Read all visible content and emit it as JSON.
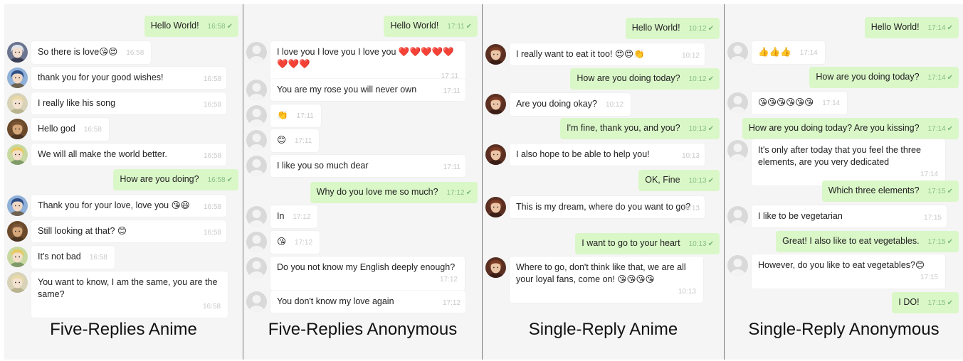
{
  "figure_colors": {
    "background": "#f5f5f5",
    "outgoing_bubble": "#daf7c8",
    "incoming_bubble": "#ffffff",
    "divider": "#7a7a7a"
  },
  "panels": [
    {
      "caption": "Five-Replies Anime",
      "messages": [
        {
          "dir": "out",
          "text": "Hello World!",
          "time": "16:58"
        },
        {
          "dir": "in",
          "avatar": "anime-silver",
          "text": "So there is love😘😍",
          "time": "16:58"
        },
        {
          "dir": "in",
          "avatar": "anime-blue",
          "text": "thank you for your good wishes!",
          "time": "16:58"
        },
        {
          "dir": "in",
          "avatar": "anime-blonde-light",
          "text": "I really like his song",
          "time": "16:58"
        },
        {
          "dir": "in",
          "avatar": "anime-bald",
          "text": "Hello god",
          "time": "16:58"
        },
        {
          "dir": "in",
          "avatar": "anime-blonde",
          "text": "We will all make the world better.",
          "time": "16:58"
        },
        {
          "dir": "out",
          "text": "How are you doing?",
          "time": "16:58"
        },
        {
          "dir": "in",
          "avatar": "anime-blue",
          "text": "Thank you for your love, love you 😘😃",
          "time": "16:58"
        },
        {
          "dir": "in",
          "avatar": "anime-bald",
          "text": "Still looking at that? 😊",
          "time": "16:58"
        },
        {
          "dir": "in",
          "avatar": "anime-blonde",
          "text": "It's not bad",
          "time": "16:58"
        },
        {
          "dir": "in",
          "avatar": "anime-blonde-light",
          "text": "You want to know, I am the same, you are the same?",
          "time": "16:58"
        }
      ]
    },
    {
      "caption": "Five-Replies Anonymous",
      "messages": [
        {
          "dir": "out",
          "text": "Hello World!",
          "time": "17:11"
        },
        {
          "dir": "in",
          "avatar": "anonymous",
          "text": "I love you I love you I love you ❤️❤️❤️❤️❤️❤️❤️❤️",
          "time": "17:11"
        },
        {
          "dir": "in",
          "avatar": "anonymous",
          "text": "You are my rose you will never own",
          "time": "17:11"
        },
        {
          "dir": "in",
          "avatar": "anonymous",
          "text": "👏",
          "time": "17:11"
        },
        {
          "dir": "in",
          "avatar": "anonymous",
          "text": "😊",
          "time": "17:11"
        },
        {
          "dir": "in",
          "avatar": "anonymous",
          "text": "I like you so much dear",
          "time": "17:11"
        },
        {
          "dir": "out",
          "text": "Why do you love me so much?",
          "time": "17:12"
        },
        {
          "dir": "in",
          "avatar": "anonymous",
          "text": "In",
          "time": "17:12"
        },
        {
          "dir": "in",
          "avatar": "anonymous",
          "text": "😘",
          "time": "17:12"
        },
        {
          "dir": "in",
          "avatar": "anonymous",
          "text": "Do you not know my English deeply enough?",
          "time": "17:12"
        },
        {
          "dir": "in",
          "avatar": "anonymous",
          "text": "You don't know my love again",
          "time": "17:12"
        }
      ]
    },
    {
      "caption": "Single-Reply Anime",
      "messages": [
        {
          "dir": "out",
          "text": "Hello World!",
          "time": "10:12"
        },
        {
          "dir": "in",
          "avatar": "anime-brunette",
          "text": "I really want to eat it too! 😍😍👏",
          "time": "10:12"
        },
        {
          "dir": "out",
          "text": "How are you doing today?",
          "time": "10:12"
        },
        {
          "dir": "in",
          "avatar": "anime-brunette",
          "text": "Are you doing okay?",
          "time": "10:12"
        },
        {
          "dir": "out",
          "text": "I'm fine, thank you, and you?",
          "time": "10:13"
        },
        {
          "dir": "in",
          "avatar": "anime-brunette",
          "text": "I also hope to be able to help you!",
          "time": "10:13"
        },
        {
          "dir": "out",
          "text": "OK, Fine",
          "time": "10:13"
        },
        {
          "dir": "in",
          "avatar": "anime-brunette",
          "text": "This is my dream, where do you want to go?",
          "time": "10:13"
        },
        {
          "dir": "out",
          "text": "I want to go to your heart",
          "time": "10:13"
        },
        {
          "dir": "in",
          "avatar": "anime-brunette",
          "text": "Where to go, don't think like that, we are all your loyal fans, come on! 😘😘😘😘",
          "time": "10:13"
        }
      ]
    },
    {
      "caption": "Single-Reply Anonymous",
      "messages": [
        {
          "dir": "out",
          "text": "Hello World!",
          "time": "17:14"
        },
        {
          "dir": "in",
          "avatar": "anonymous",
          "text": "👍👍👍",
          "time": "17:14"
        },
        {
          "dir": "out",
          "text": "How are you doing today?",
          "time": "17:14"
        },
        {
          "dir": "in",
          "avatar": "anonymous",
          "text": "😘😘😘😘😘😘",
          "time": "17:14"
        },
        {
          "dir": "out",
          "text": "How are you doing today? Are you kissing?",
          "time": "17:14"
        },
        {
          "dir": "in",
          "avatar": "anonymous",
          "text": "It's only after today that you feel the three elements, are you very dedicated",
          "time": "17:14"
        },
        {
          "dir": "out",
          "text": "Which three elements?",
          "time": "17:15"
        },
        {
          "dir": "in",
          "avatar": "anonymous",
          "text": "I like to be vegetarian",
          "time": "17:15"
        },
        {
          "dir": "out",
          "text": "Great! I also like to eat vegetables.",
          "time": "17:15"
        },
        {
          "dir": "in",
          "avatar": "anonymous",
          "text": "However, do you like to eat vegetables?😊",
          "time": "17:15"
        },
        {
          "dir": "out",
          "text": "I DO!",
          "time": "17:15"
        }
      ]
    }
  ]
}
